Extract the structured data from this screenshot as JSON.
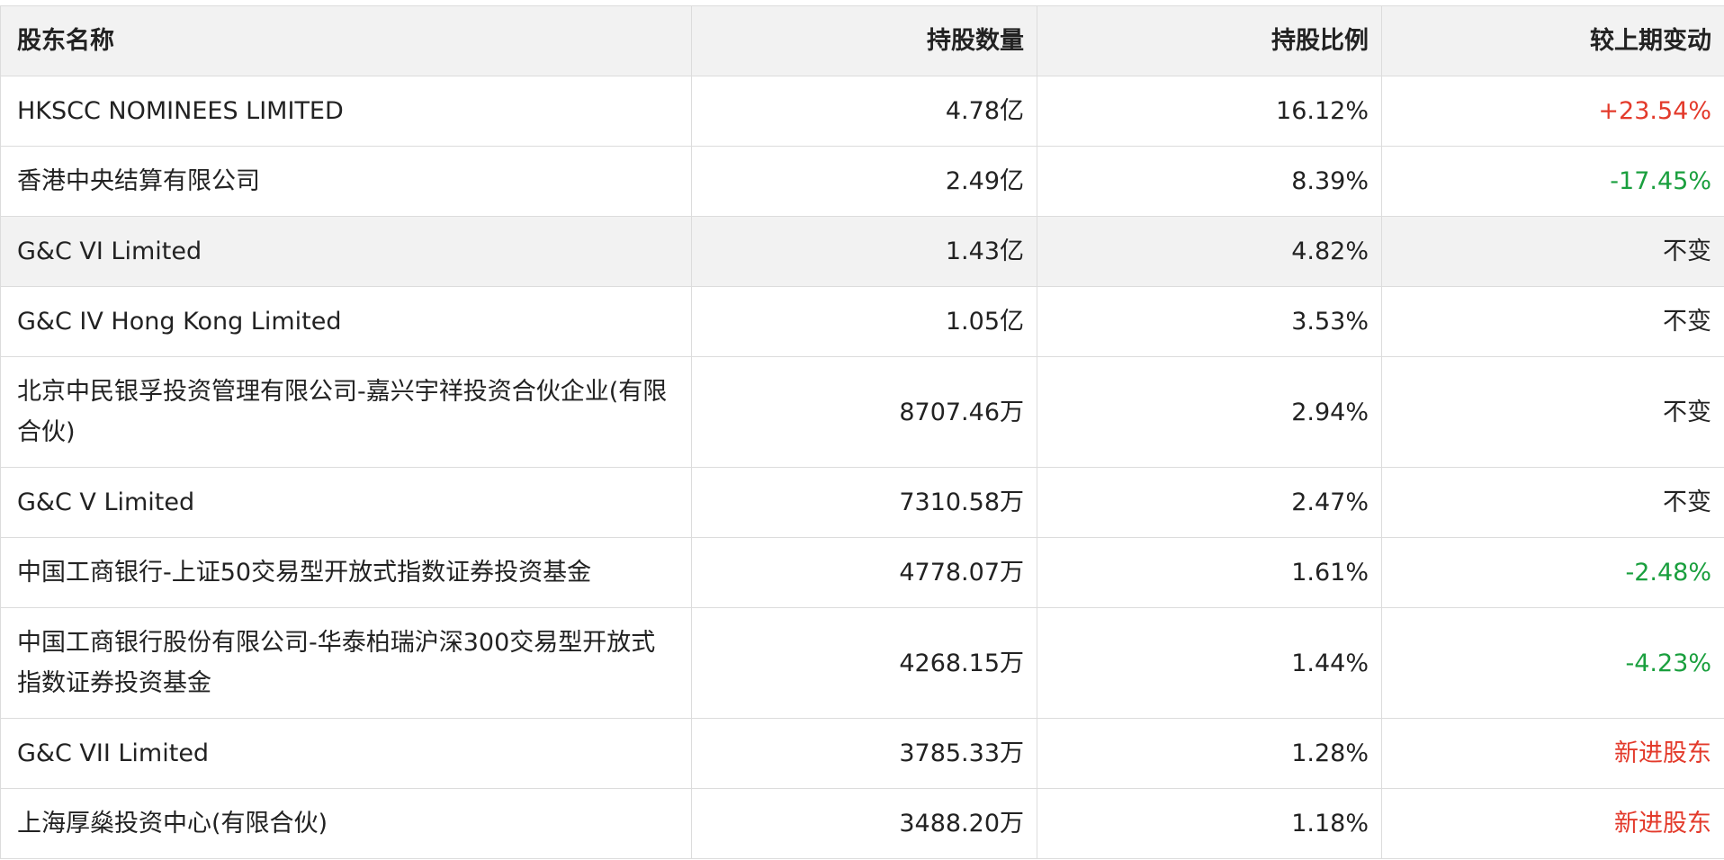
{
  "header": {
    "name": "股东名称",
    "quantity": "持股数量",
    "ratio": "持股比例",
    "change": "较上期变动"
  },
  "rows": [
    {
      "name": "HKSCC NOMINEES LIMITED",
      "quantity": "4.78亿",
      "ratio": "16.12%",
      "change": "+23.54%",
      "change_type": "pos"
    },
    {
      "name": "香港中央结算有限公司",
      "quantity": "2.49亿",
      "ratio": "8.39%",
      "change": "-17.45%",
      "change_type": "neg"
    },
    {
      "name": "G&C VI Limited",
      "quantity": "1.43亿",
      "ratio": "4.82%",
      "change": "不变",
      "change_type": "flat"
    },
    {
      "name": "G&C IV Hong Kong Limited",
      "quantity": "1.05亿",
      "ratio": "3.53%",
      "change": "不变",
      "change_type": "flat"
    },
    {
      "name": "北京中民银孚投资管理有限公司-嘉兴宇祥投资合伙企业(有限合伙)",
      "quantity": "8707.46万",
      "ratio": "2.94%",
      "change": "不变",
      "change_type": "flat"
    },
    {
      "name": "G&C V Limited",
      "quantity": "7310.58万",
      "ratio": "2.47%",
      "change": "不变",
      "change_type": "flat"
    },
    {
      "name": "中国工商银行-上证50交易型开放式指数证券投资基金",
      "quantity": "4778.07万",
      "ratio": "1.61%",
      "change": "-2.48%",
      "change_type": "neg"
    },
    {
      "name": "中国工商银行股份有限公司-华泰柏瑞沪深300交易型开放式指数证券投资基金",
      "quantity": "4268.15万",
      "ratio": "1.44%",
      "change": "-4.23%",
      "change_type": "neg"
    },
    {
      "name": "G&C VII Limited",
      "quantity": "3785.33万",
      "ratio": "1.28%",
      "change": "新进股东",
      "change_type": "new"
    },
    {
      "name": "上海厚燊投资中心(有限合伙)",
      "quantity": "3488.20万",
      "ratio": "1.18%",
      "change": "新进股东",
      "change_type": "new"
    }
  ],
  "colors": {
    "positive": "#e33a2b",
    "negative": "#1a9f3e",
    "header_bg": "#f2f2f2",
    "border": "#dcdcdc"
  }
}
